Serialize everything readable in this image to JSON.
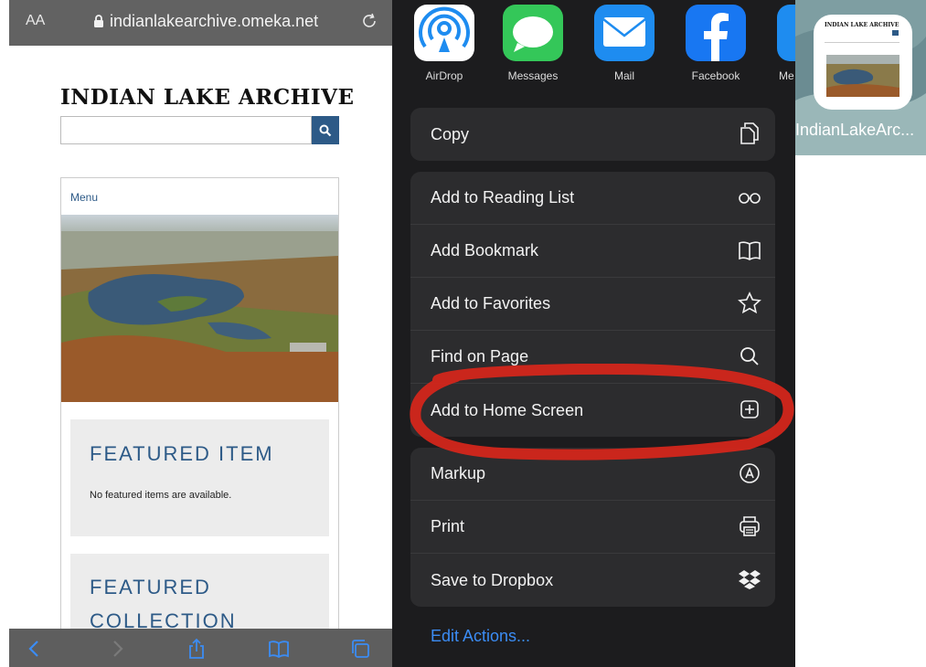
{
  "browser": {
    "reader_label": "AA",
    "url": "indianlakearchive.omeka.net"
  },
  "site": {
    "title": "INDIAN LAKE ARCHIVE",
    "menu_label": "Menu",
    "featured_item_heading": "FEATURED ITEM",
    "featured_item_text": "No featured items are available.",
    "featured_collection_line1": "FEATURED",
    "featured_collection_line2": "COLLECTION"
  },
  "share_apps": [
    {
      "label": "AirDrop",
      "icon": "airdrop-icon"
    },
    {
      "label": "Messages",
      "icon": "messages-icon"
    },
    {
      "label": "Mail",
      "icon": "mail-icon"
    },
    {
      "label": "Facebook",
      "icon": "facebook-icon"
    },
    {
      "label": "Me",
      "icon": "messenger-icon"
    }
  ],
  "actions": {
    "copy": "Copy",
    "reading_list": "Add to Reading List",
    "bookmark": "Add Bookmark",
    "favorites": "Add to Favorites",
    "find": "Find on Page",
    "home_screen": "Add to Home Screen",
    "markup": "Markup",
    "print": "Print",
    "dropbox": "Save to Dropbox",
    "edit": "Edit Actions..."
  },
  "home_icon": {
    "label": "IndianLakeArc...",
    "thumb_title": "INDIAN LAKE ARCHIVE"
  },
  "colors": {
    "link_blue": "#2d5a87",
    "ios_blue": "#3b8cf4",
    "highlight_red": "#d8261b"
  }
}
